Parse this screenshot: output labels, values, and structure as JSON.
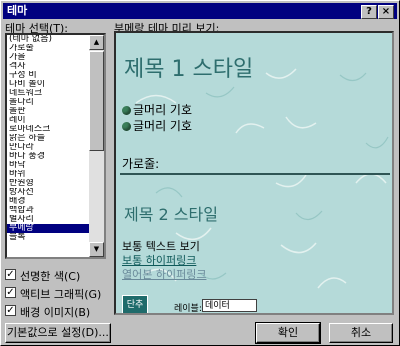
{
  "window": {
    "title": "테마",
    "help_glyph": "?",
    "close_glyph": "×"
  },
  "theme_list": {
    "label": "테마 선택(T):",
    "items": [
      "(테마 없음)",
      "가로줄",
      "가을",
      "격자",
      "구성 비",
      "나비 놀이",
      "네트워크",
      "돌다리",
      "돌판",
      "레이",
      "로마네스크",
      "맑은 하늘",
      "만다라",
      "바다 풍경",
      "바닥",
      "바위",
      "반원형",
      "방사선",
      "배경",
      "백합과",
      "별자리",
      "부메랑",
      "블록"
    ],
    "selected_index": 21
  },
  "options": [
    {
      "label": "선명한 색(C)",
      "checked": true
    },
    {
      "label": "액티브 그래픽(G)",
      "checked": true
    },
    {
      "label": "배경 이미지(B)",
      "checked": true
    }
  ],
  "preview": {
    "label": "부메랑 테마 미리 보기:",
    "heading1": "제목 1 스타일",
    "bullets": [
      "글머리 기호",
      "글머리 기호"
    ],
    "hr_label": "가로줄:",
    "heading2": "제목 2 스타일",
    "body_text": "보통 텍스트 보기",
    "link": "보통 하이퍼링크",
    "visited_link": "열어본 하이퍼링크",
    "button": "단추",
    "field_label": "레이블:",
    "field_value": "데이터"
  },
  "buttons": {
    "set_default": "기본값으로 설정(D)...",
    "ok": "확인",
    "cancel": "취소"
  },
  "colors": {
    "title_bar": "#000080",
    "preview_bg": "#b5dad9",
    "heading": "#2e6e6e",
    "link": "#0f5a5a",
    "visited_link": "#6a8a9a",
    "selection": "#000080"
  }
}
